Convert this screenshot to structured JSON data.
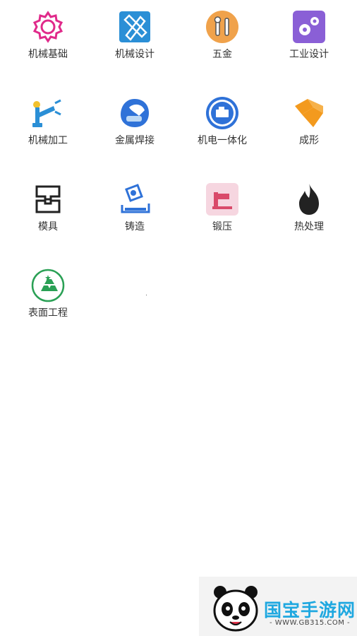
{
  "categories": [
    {
      "label": "机械基础",
      "icon": "gear-outline-icon",
      "color": "#e02a8a"
    },
    {
      "label": "机械设计",
      "icon": "ruler-pencil-icon",
      "color": "#2b8fd6"
    },
    {
      "label": "五金",
      "icon": "wrench-screwdriver-icon",
      "color": "#f0a24b"
    },
    {
      "label": "工业设计",
      "icon": "gears-icon",
      "color": "#8a5fd6"
    },
    {
      "label": "机械加工",
      "icon": "robot-arm-icon",
      "color": "#2b8fd6"
    },
    {
      "label": "金属焊接",
      "icon": "welding-mask-icon",
      "color": "#2f72d8"
    },
    {
      "label": "机电一体化",
      "icon": "engine-badge-icon",
      "color": "#2f72d8"
    },
    {
      "label": "成形",
      "icon": "folded-sheet-icon",
      "color": "#f39a1e"
    },
    {
      "label": "模具",
      "icon": "mold-icon",
      "color": "#222222"
    },
    {
      "label": "铸造",
      "icon": "casting-icon",
      "color": "#2f72d8"
    },
    {
      "label": "锻压",
      "icon": "press-icon",
      "color": "#d94a6a"
    },
    {
      "label": "热处理",
      "icon": "flame-icon",
      "color": "#222222"
    },
    {
      "label": "表面工程",
      "icon": "gold-bars-icon",
      "color": "#2aa055"
    }
  ],
  "watermark": {
    "title": "国宝手游网",
    "url": "- WWW.GB315.COM -",
    "icon": "panda-icon"
  }
}
